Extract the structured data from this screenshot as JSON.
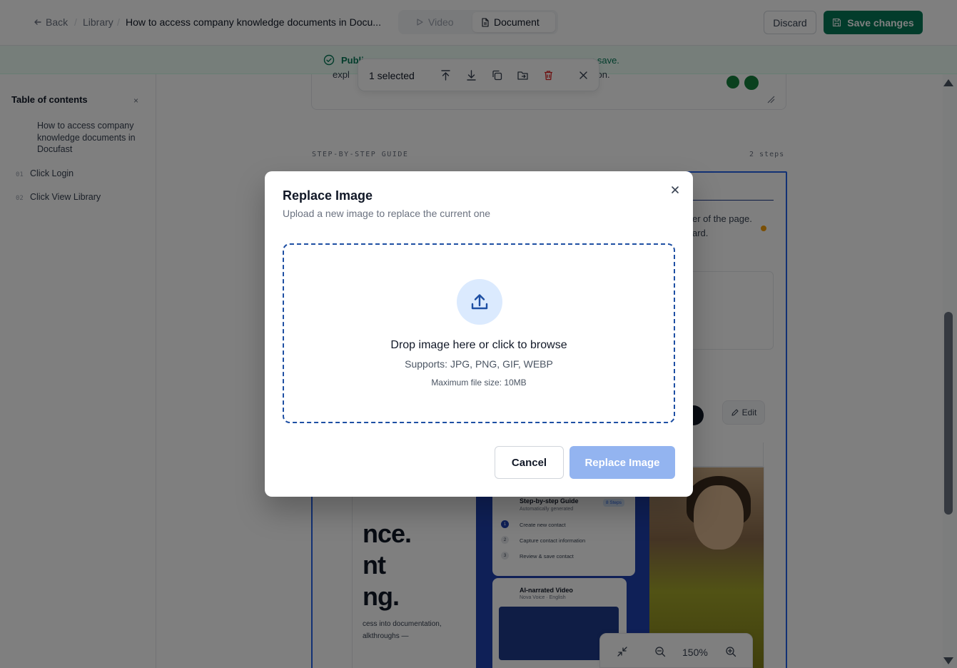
{
  "header": {
    "back_label": "Back",
    "breadcrumb_library": "Library",
    "doc_title": "How to access company knowledge documents in Docu...",
    "tab_video": "Video",
    "tab_document": "Document",
    "discard_label": "Discard",
    "save_label": "Save changes"
  },
  "banner": {
    "text_start": "Publi",
    "text_end": "u save."
  },
  "selection_toolbar": {
    "count_label": "1 selected"
  },
  "sidebar": {
    "title": "Table of contents",
    "close_glyph": "×",
    "main_item": "How to access company knowledge documents in Docufast",
    "steps": [
      {
        "num": "01",
        "label": "Click Login"
      },
      {
        "num": "02",
        "label": "Click View Library"
      }
    ]
  },
  "editor": {
    "top_text_left": "expl",
    "top_text_right": "tion.",
    "guide_label": "STEP-BY-STEP GUIDE",
    "steps_count": "2 steps",
    "step_text_a": "er of the page.",
    "step_text_b": "ard.",
    "edit_label": "Edit",
    "shot_big_1": "nce.",
    "shot_big_2": "nt",
    "shot_big_3": "ng.",
    "shot_small_1": "cess into documentation,",
    "shot_small_2": "alkthroughs —",
    "shot_card_title": "Step-by-step Guide",
    "shot_card_sub": "Automatically generated",
    "shot_card_badge": "8 Steps",
    "shot_card_items": [
      "Create new contact",
      "Capture contact information",
      "Review & save contact"
    ],
    "shot_video_title": "AI-narrated Video",
    "shot_video_sub": "Nova Voice · English",
    "zoom_level": "150%"
  },
  "modal": {
    "title": "Replace Image",
    "subtitle": "Upload a new image to replace the current one",
    "drop_text": "Drop image here or click to browse",
    "supports_text": "Supports: JPG, PNG, GIF, WEBP",
    "max_size_text": "Maximum file size: 10MB",
    "cancel_label": "Cancel",
    "replace_label": "Replace Image"
  },
  "colors": {
    "accent_blue": "#1e4fa3",
    "save_green": "#047857",
    "replace_disabled": "#93b4f0"
  },
  "icons": {
    "back": "arrow-left-icon",
    "video": "play-icon",
    "document": "file-icon",
    "save": "save-icon",
    "banner": "check-circle-icon",
    "upload": "upload-icon",
    "close": "close-icon"
  }
}
